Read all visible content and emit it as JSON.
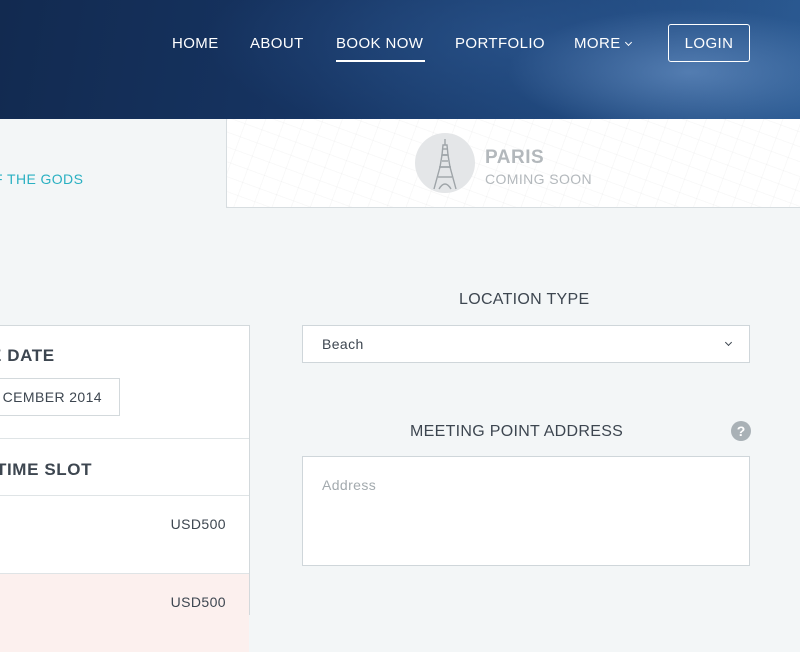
{
  "nav": {
    "items": [
      {
        "label": "HOME",
        "active": false
      },
      {
        "label": "ABOUT",
        "active": false
      },
      {
        "label": "BOOK NOW",
        "active": true
      },
      {
        "label": "PORTFOLIO",
        "active": false
      },
      {
        "label": "MORE",
        "active": false
      }
    ],
    "login_label": "LOGIN"
  },
  "tabs": {
    "left_label": "F THE GODS",
    "right_title": "PARIS",
    "right_subtitle": "COMING SOON",
    "right_icon": "eiffel-tower-icon"
  },
  "booking": {
    "date_title": "E DATE",
    "date_value": "CEMBER 2014",
    "slot_title": "TIME SLOT",
    "slots": [
      {
        "price": "USD500",
        "selected": false
      },
      {
        "price": "USD500",
        "selected": true
      }
    ]
  },
  "form": {
    "location_label": "LOCATION TYPE",
    "location_value": "Beach",
    "meeting_label": "MEETING POINT ADDRESS",
    "help_glyph": "?",
    "address_placeholder": "Address"
  },
  "colors": {
    "header_dark": "#122a50",
    "header_light": "#2b5a92",
    "accent_teal": "#2ab0c2",
    "selected_row": "#fcf0ee",
    "text": "#3d4650"
  }
}
